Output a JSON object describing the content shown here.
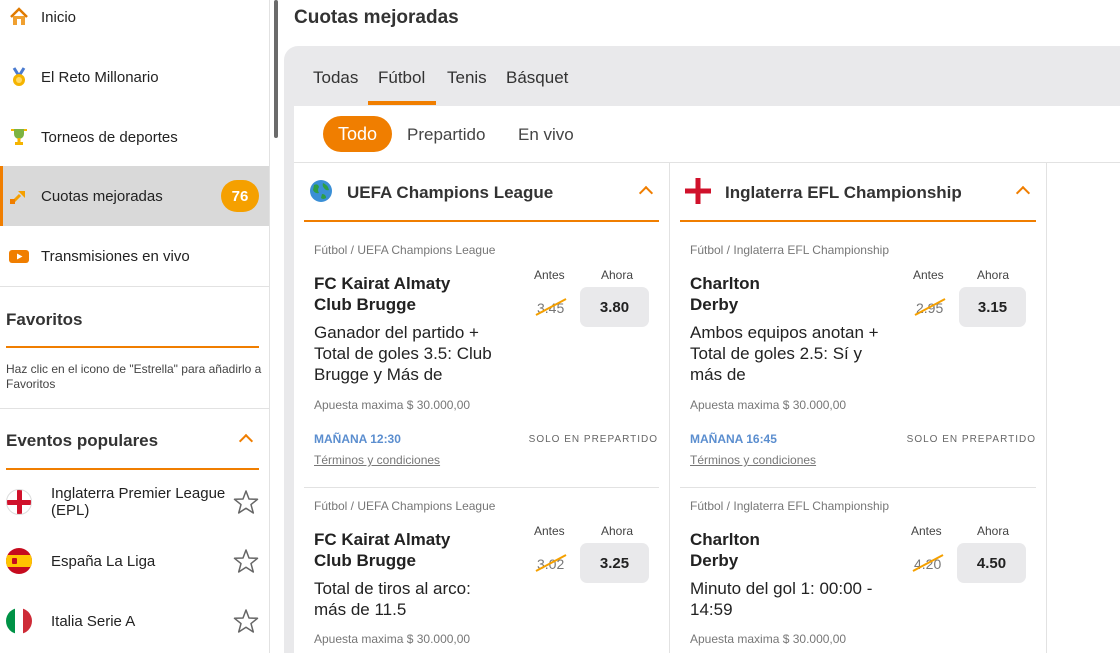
{
  "sidebar": {
    "nav": [
      {
        "label": "Inicio",
        "icon": "home-icon"
      },
      {
        "label": "El Reto Millonario",
        "icon": "medal-icon"
      },
      {
        "label": "Torneos de deportes",
        "icon": "trophy-icon"
      },
      {
        "label": "Cuotas mejoradas",
        "icon": "boost-icon",
        "badge": "76",
        "active": true
      },
      {
        "label": "Transmisiones en vivo",
        "icon": "live-stream-icon"
      }
    ],
    "favorites": {
      "title": "Favoritos",
      "hint": "Haz clic en el icono de \"Estrella\" para añadirlo a Favoritos"
    },
    "popular": {
      "title": "Eventos populares",
      "items": [
        {
          "label": "Inglaterra Premier League (EPL)",
          "flag": "england-flag-icon"
        },
        {
          "label": "España La Liga",
          "flag": "spain-flag-icon"
        },
        {
          "label": "Italia Serie A",
          "flag": "italy-flag-icon"
        }
      ]
    }
  },
  "main": {
    "title": "Cuotas mejoradas",
    "tabs": [
      "Todas",
      "Fútbol",
      "Tenis",
      "Básquet"
    ],
    "active_tab": "Fútbol",
    "subtabs": [
      "Todo",
      "Prepartido",
      "En vivo"
    ],
    "columns": [
      {
        "title": "UEFA Champions League",
        "icon": "globe-icon",
        "cards": [
          {
            "crumb": "Fútbol / UEFA Champions League",
            "team1": "FC Kairat Almaty",
            "team2": "Club Brugge",
            "market": "Ganador del partido + Total de goles 3.5: Club Brugge y Más de",
            "before_label": "Antes",
            "now_label": "Ahora",
            "before": "3.45",
            "now": "3.80",
            "max_bet": "Apuesta maxima $ 30.000,00",
            "when": "MAÑANA 12:30",
            "only": "SOLO EN PREPARTIDO",
            "terms": "Términos y condiciones"
          },
          {
            "crumb": "Fútbol / UEFA Champions League",
            "team1": "FC Kairat Almaty",
            "team2": "Club Brugge",
            "market": "Total de tiros al arco: más de 11.5",
            "before_label": "Antes",
            "now_label": "Ahora",
            "before": "3.02",
            "now": "3.25",
            "max_bet": "Apuesta maxima $ 30.000,00"
          }
        ]
      },
      {
        "title": "Inglaterra EFL Championship",
        "icon": "england-flag-icon",
        "cards": [
          {
            "crumb": "Fútbol / Inglaterra EFL Championship",
            "team1": "Charlton",
            "team2": "Derby",
            "market": "Ambos equipos anotan + Total de goles 2.5: Sí y más de",
            "before_label": "Antes",
            "now_label": "Ahora",
            "before": "2.95",
            "now": "3.15",
            "max_bet": "Apuesta maxima $ 30.000,00",
            "when": "MAÑANA 16:45",
            "only": "SOLO EN PREPARTIDO",
            "terms": "Términos y condiciones"
          },
          {
            "crumb": "Fútbol / Inglaterra EFL Championship",
            "team1": "Charlton",
            "team2": "Derby",
            "market": "Minuto del gol 1: 00:00 - 14:59",
            "before_label": "Antes",
            "now_label": "Ahora",
            "before": "4.20",
            "now": "4.50",
            "max_bet": "Apuesta maxima $ 30.000,00"
          }
        ]
      }
    ]
  },
  "colors": {
    "accent": "#f07e00",
    "badge": "#f5a000",
    "link_blue": "#5b8ecf"
  }
}
